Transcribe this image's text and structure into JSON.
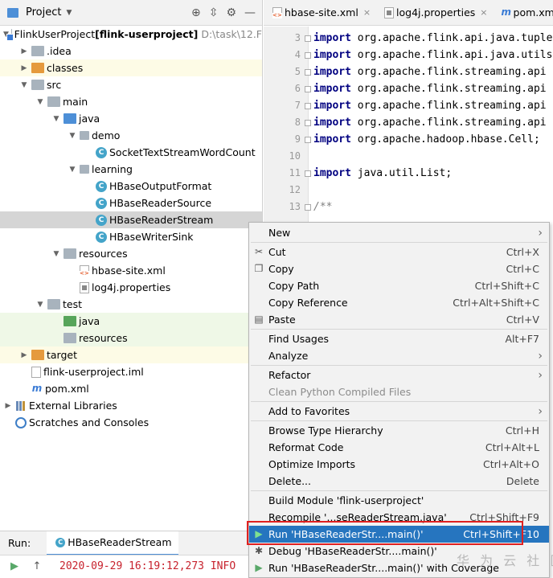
{
  "project_panel": {
    "title": "Project",
    "header_icons": [
      "crosshair-icon",
      "collapse-icon",
      "gear-icon",
      "minimize-icon"
    ],
    "tree": [
      {
        "label": "FlinkUserProject",
        "bold_suffix": "[flink-userproject]",
        "path": "D:\\task\\12.F",
        "depth": 0,
        "expanded": true,
        "icon": "module-folder"
      },
      {
        "label": ".idea",
        "depth": 1,
        "expanded": false,
        "icon": "folder"
      },
      {
        "label": "classes",
        "depth": 1,
        "expanded": false,
        "icon": "folder-orange",
        "bg": "yellow"
      },
      {
        "label": "src",
        "depth": 1,
        "expanded": true,
        "icon": "folder"
      },
      {
        "label": "main",
        "depth": 2,
        "expanded": true,
        "icon": "folder"
      },
      {
        "label": "java",
        "depth": 3,
        "expanded": true,
        "icon": "folder-blue"
      },
      {
        "label": "demo",
        "depth": 4,
        "expanded": true,
        "icon": "package"
      },
      {
        "label": "SocketTextStreamWordCount",
        "depth": 5,
        "icon": "class"
      },
      {
        "label": "learning",
        "depth": 4,
        "expanded": true,
        "icon": "package"
      },
      {
        "label": "HBaseOutputFormat",
        "depth": 5,
        "icon": "class"
      },
      {
        "label": "HBaseReaderSource",
        "depth": 5,
        "icon": "class"
      },
      {
        "label": "HBaseReaderStream",
        "depth": 5,
        "icon": "class",
        "selected": true
      },
      {
        "label": "HBaseWriterSink",
        "depth": 5,
        "icon": "class"
      },
      {
        "label": "resources",
        "depth": 3,
        "expanded": true,
        "icon": "folder-resources"
      },
      {
        "label": "hbase-site.xml",
        "depth": 4,
        "icon": "xml"
      },
      {
        "label": "log4j.properties",
        "depth": 4,
        "icon": "properties"
      },
      {
        "label": "test",
        "depth": 2,
        "expanded": true,
        "icon": "folder"
      },
      {
        "label": "java",
        "depth": 3,
        "icon": "folder-green",
        "bg": "green"
      },
      {
        "label": "resources",
        "depth": 3,
        "icon": "folder-resources",
        "bg": "green"
      },
      {
        "label": "target",
        "depth": 1,
        "expanded": false,
        "icon": "folder-orange",
        "bg": "yellow"
      },
      {
        "label": "flink-userproject.iml",
        "depth": 1,
        "icon": "iml"
      },
      {
        "label": "pom.xml",
        "depth": 1,
        "icon": "pom"
      },
      {
        "label": "External Libraries",
        "depth": 0,
        "expanded": false,
        "icon": "libraries"
      },
      {
        "label": "Scratches and Consoles",
        "depth": 0,
        "icon": "scratches"
      }
    ]
  },
  "editor_tabs": [
    {
      "label": "hbase-site.xml",
      "icon": "xml"
    },
    {
      "label": "log4j.properties",
      "icon": "properties"
    },
    {
      "label": "pom.xml",
      "icon": "pom"
    }
  ],
  "code_lines": [
    {
      "num": "3",
      "kw": "import",
      "text": " org.apache.flink.api.java.tuple"
    },
    {
      "num": "4",
      "kw": "import",
      "text": " org.apache.flink.api.java.utils"
    },
    {
      "num": "5",
      "kw": "import",
      "text": " org.apache.flink.streaming.api"
    },
    {
      "num": "6",
      "kw": "import",
      "text": " org.apache.flink.streaming.api"
    },
    {
      "num": "7",
      "kw": "import",
      "text": " org.apache.flink.streaming.api"
    },
    {
      "num": "8",
      "kw": "import",
      "text": " org.apache.flink.streaming.api"
    },
    {
      "num": "9",
      "kw": "import",
      "text": " org.apache.hadoop.hbase.Cell;"
    },
    {
      "num": "10",
      "kw": "",
      "text": ""
    },
    {
      "num": "11",
      "kw": "import",
      "text": " java.util.List;"
    },
    {
      "num": "12",
      "kw": "",
      "text": ""
    },
    {
      "num": "13",
      "kw": "",
      "text": "/**",
      "comment": true
    }
  ],
  "context_menu": {
    "items": [
      {
        "label": "New",
        "submenu": true
      },
      {
        "sep": true
      },
      {
        "label": "Cut",
        "shortcut": "Ctrl+X",
        "icon": "scissors-icon"
      },
      {
        "label": "Copy",
        "shortcut": "Ctrl+C",
        "icon": "copy-icon"
      },
      {
        "label": "Copy Path",
        "shortcut": "Ctrl+Shift+C"
      },
      {
        "label": "Copy Reference",
        "shortcut": "Ctrl+Alt+Shift+C"
      },
      {
        "label": "Paste",
        "shortcut": "Ctrl+V",
        "icon": "paste-icon"
      },
      {
        "sep": true
      },
      {
        "label": "Find Usages",
        "shortcut": "Alt+F7"
      },
      {
        "label": "Analyze",
        "submenu": true
      },
      {
        "sep": true
      },
      {
        "label": "Refactor",
        "submenu": true
      },
      {
        "label": "Clean Python Compiled Files",
        "disabled": true
      },
      {
        "sep": true
      },
      {
        "label": "Add to Favorites",
        "submenu": true
      },
      {
        "sep": true
      },
      {
        "label": "Browse Type Hierarchy",
        "shortcut": "Ctrl+H"
      },
      {
        "label": "Reformat Code",
        "shortcut": "Ctrl+Alt+L"
      },
      {
        "label": "Optimize Imports",
        "shortcut": "Ctrl+Alt+O"
      },
      {
        "label": "Delete...",
        "shortcut": "Delete"
      },
      {
        "sep": true
      },
      {
        "label": "Build Module 'flink-userproject'"
      },
      {
        "label": "Recompile '...seReaderStream.java'",
        "shortcut": "Ctrl+Shift+F9"
      },
      {
        "label": "Run 'HBaseReaderStr....main()'",
        "shortcut": "Ctrl+Shift+F10",
        "icon": "run-icon",
        "highlighted": true
      },
      {
        "label": "Debug 'HBaseReaderStr....main()'",
        "icon": "debug-icon"
      },
      {
        "label": "Run 'HBaseReaderStr....main()' with Coverage",
        "icon": "coverage-icon"
      }
    ]
  },
  "run_panel": {
    "label": "Run:",
    "tab": "HBaseReaderStream",
    "log_line": "2020-09-29 16:19:12,273 INFO"
  },
  "watermark": "华 为 云 社 区",
  "colors": {
    "selection": "#2675bf",
    "highlight_box": "#e02020",
    "keyword": "#000080",
    "log_text": "#c7222d"
  }
}
